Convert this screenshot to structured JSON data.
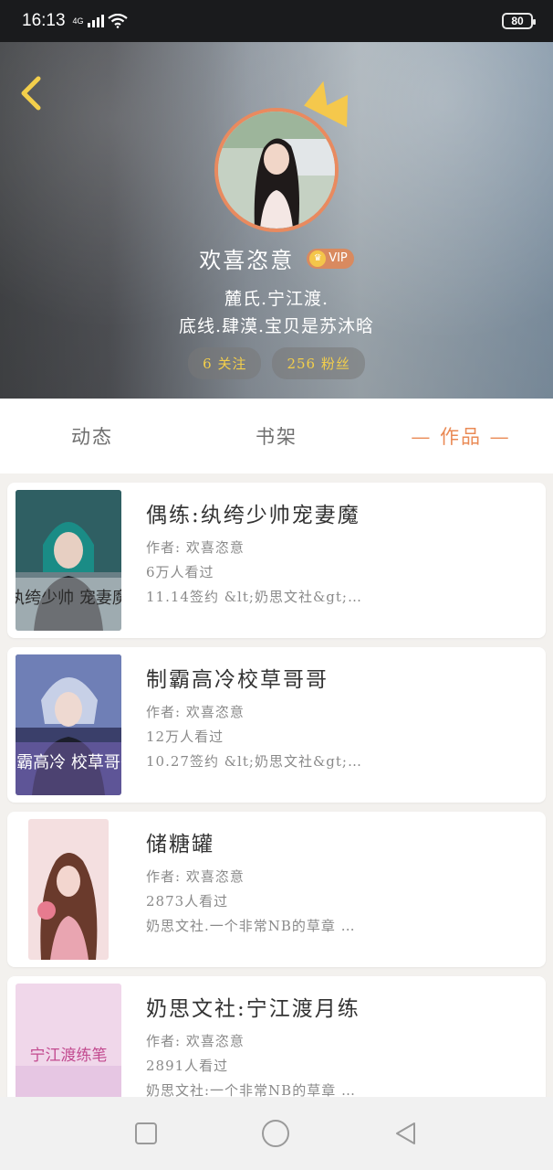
{
  "status_bar": {
    "time": "16:13",
    "network": "4G",
    "battery": "80"
  },
  "profile": {
    "name": "欢喜恣意",
    "vip_label": "VIP",
    "bio_line1": "麓氏.宁江渡.",
    "bio_line2": "底线.肆漠.宝贝是苏沐晗",
    "following": "6 关注",
    "followers": "256 粉丝"
  },
  "tabs": [
    {
      "label": "动态"
    },
    {
      "label": "书架"
    },
    {
      "label": "— 作品 —"
    }
  ],
  "works": [
    {
      "title": "偶练:纨绔少帅宠妻魔",
      "author": "作者: 欢喜恣意",
      "views": "6万人看过",
      "desc": "11.14签约 &lt;奶思文社&gt;…",
      "cover_text": "纨绔少帅 宠妻魔"
    },
    {
      "title": "制霸高冷校草哥哥",
      "author": "作者: 欢喜恣意",
      "views": "12万人看过",
      "desc": "10.27签约 &lt;奶思文社&gt;…",
      "cover_text": "制霸高冷 校草哥哥"
    },
    {
      "title": "储糖罐",
      "author": "作者: 欢喜恣意",
      "views": "2873人看过",
      "desc": "奶思文社.一个非常NB的草章 …",
      "cover_text": ""
    },
    {
      "title": "奶思文社:宁江渡月练",
      "author": "作者: 欢喜恣意",
      "views": "2891人看过",
      "desc": "奶思文社:一个非常NB的草章 …",
      "cover_text": "宁江渡练笔"
    }
  ],
  "colors": {
    "accent": "#ea8a55",
    "gold": "#f3cf4b"
  }
}
